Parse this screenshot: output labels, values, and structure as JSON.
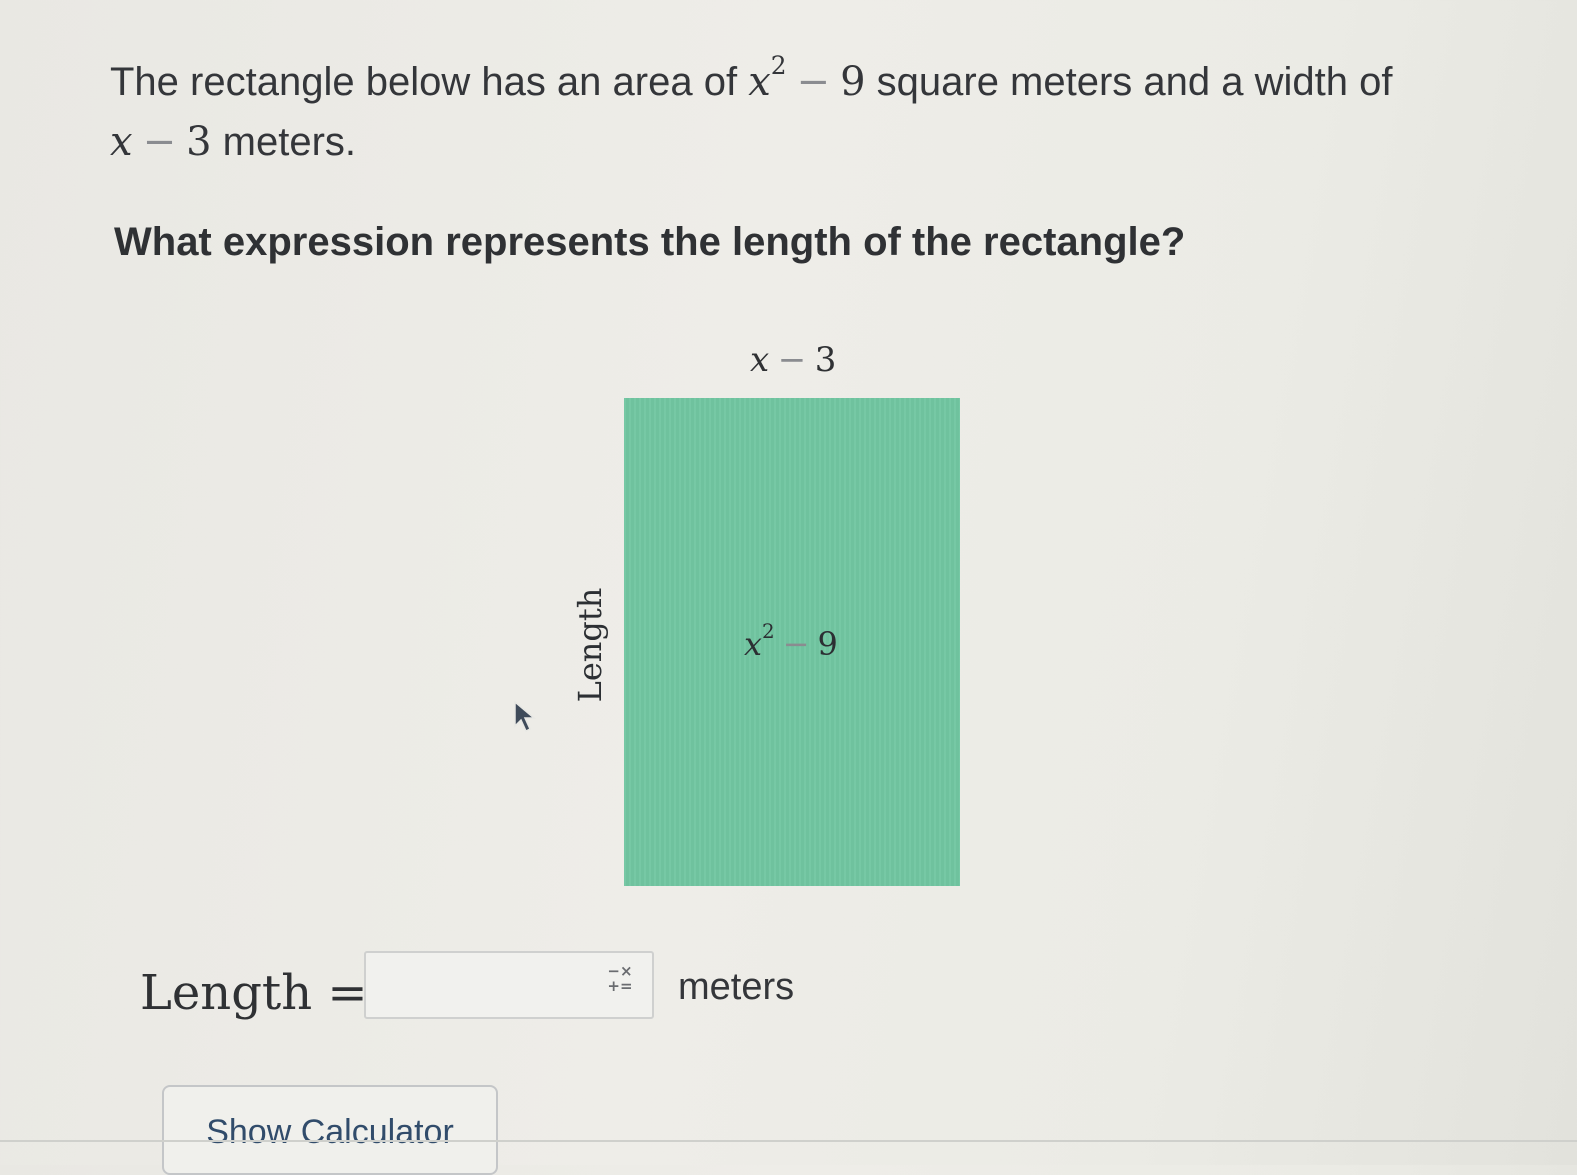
{
  "problem": {
    "intro_part1": "The rectangle below has an area of",
    "area_var": "x",
    "area_exp": "2",
    "area_const": "9",
    "intro_part2": "square meters and a width of",
    "width_var": "x",
    "width_const": "3",
    "intro_part3": "meters.",
    "question": "What expression represents the length of the rectangle?"
  },
  "diagram": {
    "width_label_var": "x",
    "width_label_const": "3",
    "area_label_var": "x",
    "area_label_exp": "2",
    "area_label_const": "9",
    "length_label": "Length",
    "rect_color": "#71c6a1"
  },
  "answer": {
    "label": "Length",
    "equals": "=",
    "value": "",
    "unit": "meters"
  },
  "icons": {
    "math_keyboard": "math-keyboard-icon",
    "cursor": "mouse-pointer"
  },
  "buttons": {
    "show_calculator": "Show Calculator"
  }
}
